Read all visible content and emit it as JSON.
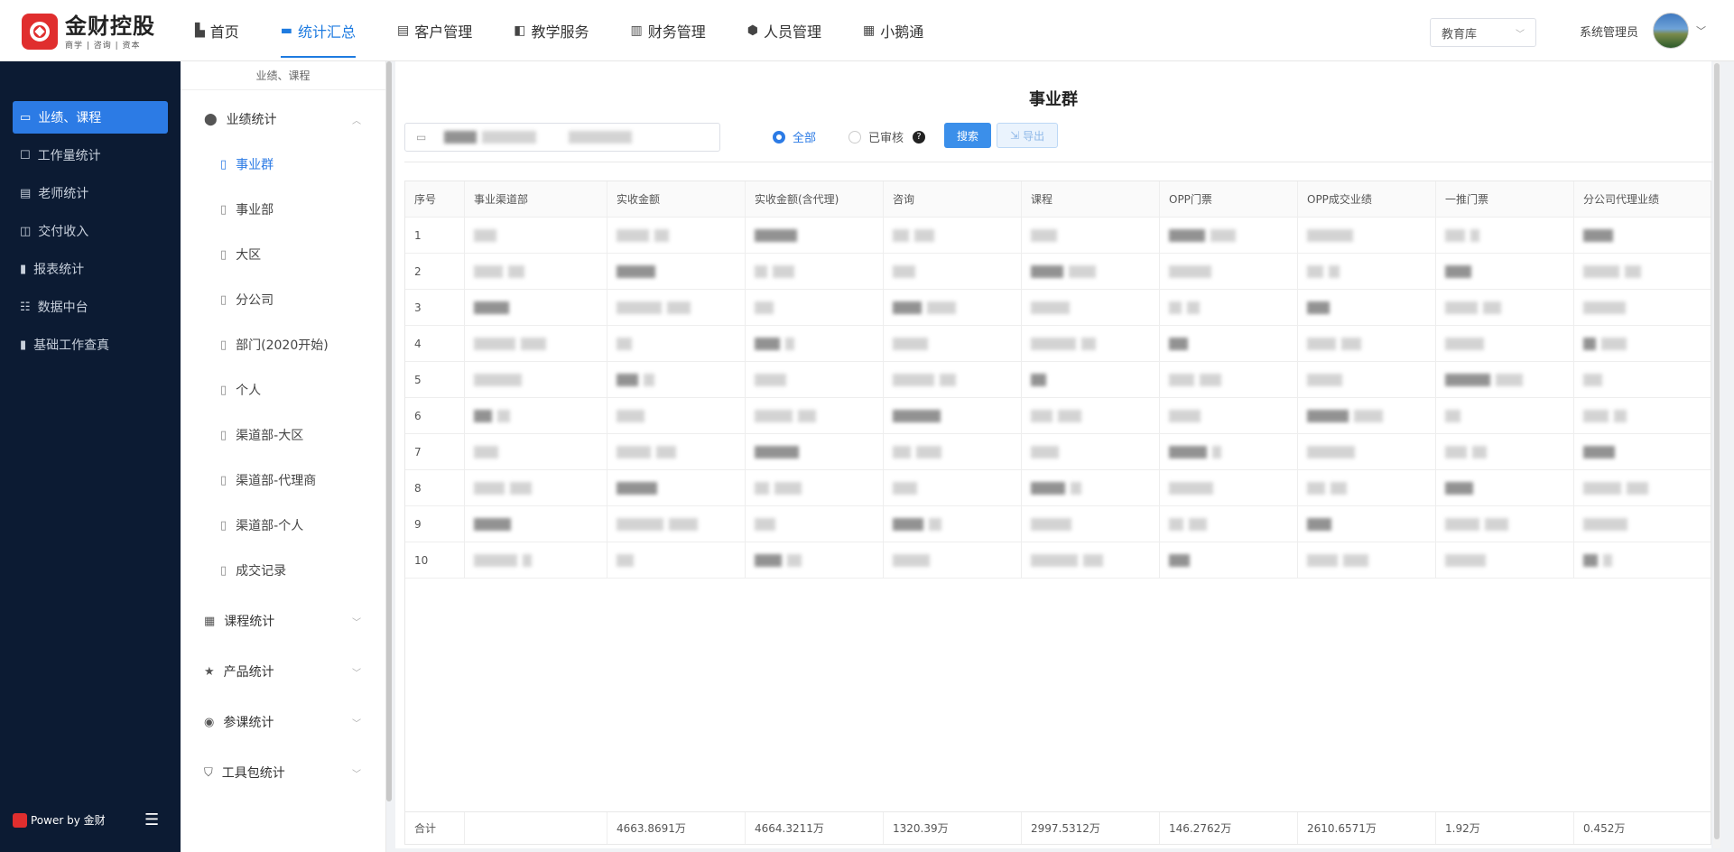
{
  "brand": {
    "title": "金财控股",
    "subtitle": "商学 | 咨询 | 资本"
  },
  "nav": [
    {
      "label": "首页",
      "icon": "chart-bars-icon"
    },
    {
      "label": "统计汇总",
      "icon": "folder-icon",
      "active": true
    },
    {
      "label": "客户管理",
      "icon": "document-icon"
    },
    {
      "label": "教学服务",
      "icon": "book-icon"
    },
    {
      "label": "财务管理",
      "icon": "list-icon"
    },
    {
      "label": "人员管理",
      "icon": "shield-icon"
    },
    {
      "label": "小鹅通",
      "icon": "calendar-icon"
    }
  ],
  "db_select": "教育库",
  "user_name": "系统管理员",
  "sidebar": {
    "items": [
      {
        "label": "业绩、课程",
        "active": true
      },
      {
        "label": "工作量统计"
      },
      {
        "label": "老师统计"
      },
      {
        "label": "交付收入"
      },
      {
        "label": "报表统计"
      },
      {
        "label": "数据中台"
      },
      {
        "label": "基础工作查真"
      }
    ],
    "powerby": "Power by 金财"
  },
  "subnav": {
    "header": "业绩、课程",
    "groups": [
      {
        "label": "业绩统计",
        "expanded": true
      },
      {
        "label": "课程统计"
      },
      {
        "label": "产品统计"
      },
      {
        "label": "参课统计"
      },
      {
        "label": "工具包统计"
      }
    ],
    "leaves": [
      {
        "label": "事业群",
        "active": true
      },
      {
        "label": "事业部"
      },
      {
        "label": "大区"
      },
      {
        "label": "分公司"
      },
      {
        "label": "部门(2020开始)"
      },
      {
        "label": "个人"
      },
      {
        "label": "渠道部-大区"
      },
      {
        "label": "渠道部-代理商"
      },
      {
        "label": "渠道部-个人"
      },
      {
        "label": "成交记录"
      }
    ]
  },
  "page_title": "事业群",
  "filter": {
    "radio_all": "全部",
    "radio_reviewed": "已审核",
    "search_label": "搜索",
    "export_label": "导出"
  },
  "table": {
    "headers": [
      "序号",
      "事业渠道部",
      "实收金额",
      "实收金额(含代理)",
      "咨询",
      "课程",
      "OPP门票",
      "OPP成交业绩",
      "一推门票",
      "分公司代理业绩"
    ],
    "rows": [
      "1",
      "2",
      "3",
      "4",
      "5",
      "6",
      "7",
      "8",
      "9",
      "10"
    ],
    "footer": [
      "合计",
      "",
      "4663.8691万",
      "4664.3211万",
      "1320.39万",
      "2997.5312万",
      "146.2762万",
      "2610.6571万",
      "1.92万",
      "0.452万"
    ]
  }
}
